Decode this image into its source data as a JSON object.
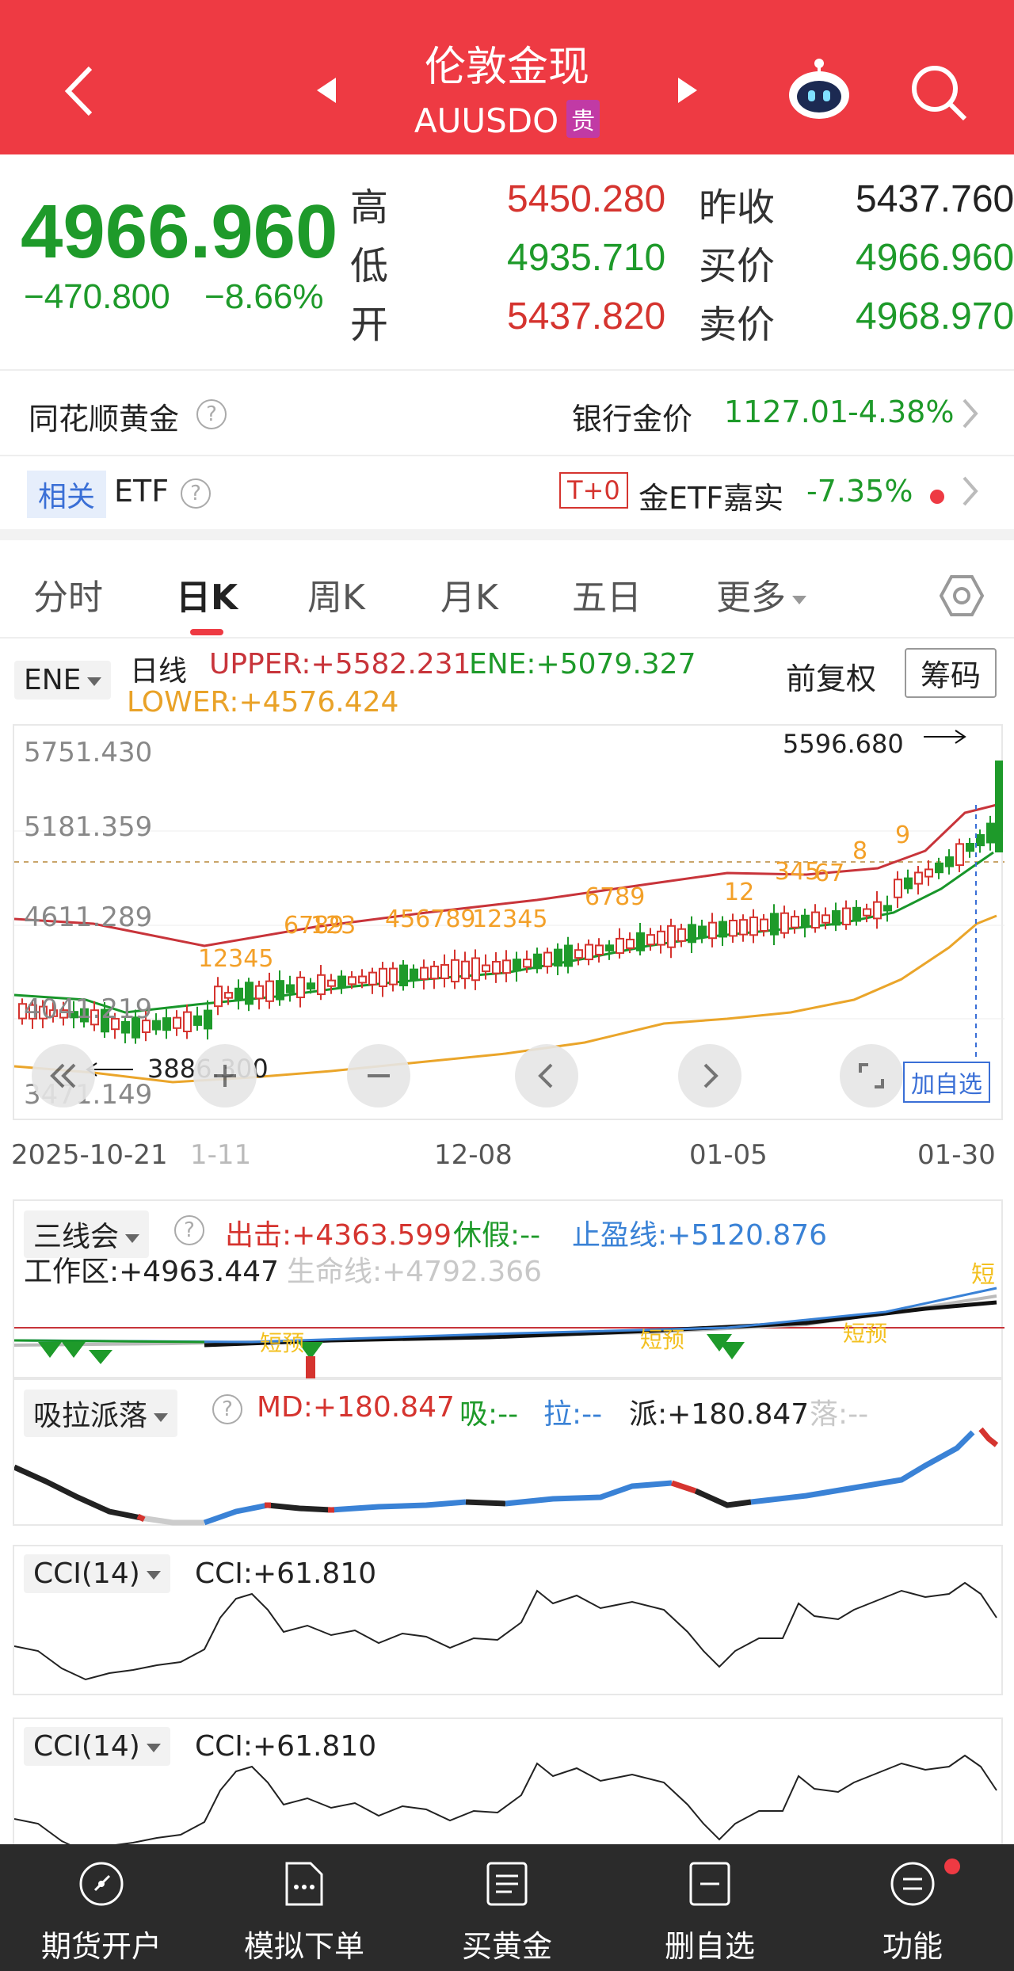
{
  "header": {
    "title": "伦敦金现",
    "symbol": "AUUSDO",
    "badge": "贵"
  },
  "quote": {
    "price": "4966.960",
    "change": "−470.800",
    "change_pct": "−8.66%",
    "high_label": "高",
    "high": "5450.280",
    "low_label": "低",
    "low": "4935.710",
    "open_label": "开",
    "open": "5437.820",
    "prev_close_label": "昨收",
    "prev_close": "5437.760",
    "bid_label": "买价",
    "bid": "4966.960",
    "ask_label": "卖价",
    "ask": "4968.970"
  },
  "ths_gold": {
    "label": "同花顺黄金",
    "bank_label": "银行金价",
    "bank_price": "1127.01",
    "bank_pct": "-4.38%"
  },
  "etf": {
    "tag": "相关",
    "label": "ETF",
    "t0": "T+0",
    "name": "金ETF嘉实",
    "pct": "-7.35%"
  },
  "tabs": [
    "分时",
    "日K",
    "周K",
    "月K",
    "五日",
    "更多"
  ],
  "kline": {
    "indicator": "ENE",
    "period": "日线",
    "upper": "UPPER:+5582.231",
    "ene": "ENE:+5079.327",
    "lower": "LOWER:+4576.424",
    "adjust": "前复权",
    "chips": "筹码",
    "y_ticks": [
      "5751.430",
      "5181.359",
      "4611.289",
      "4041.219",
      "3471.149"
    ],
    "x_ticks": [
      "2025-10-21",
      "1-11",
      "12-08",
      "01-05",
      "01-30"
    ],
    "max_label": "5596.680",
    "min_label": "3886.300",
    "add_watch": "加自选",
    "seq_labels": [
      "12345",
      "6789",
      "123",
      "456789",
      "12345",
      "6789",
      "12",
      "345",
      "67",
      "8",
      "9"
    ]
  },
  "sanxian": {
    "name": "三线会",
    "chuji": "出击:+4363.599",
    "xiujia": "休假:--",
    "zhiying": "止盈线:+5120.876",
    "work": "工作区:+4963.447",
    "life": "生命线:+4792.366",
    "tags": [
      "短",
      "短预",
      "短预",
      "短预"
    ]
  },
  "xila": {
    "name": "吸拉派落",
    "md": "MD:+180.847",
    "xi": "吸:--",
    "la": "拉:--",
    "pai": "派:+180.847",
    "luo": "落:--"
  },
  "cci1": {
    "name": "CCI(14)",
    "value": "CCI:+61.810"
  },
  "cci2": {
    "name": "CCI(14)",
    "value": "CCI:+61.810"
  },
  "nav": [
    "期货开户",
    "模拟下单",
    "买黄金",
    "删自选",
    "功能"
  ],
  "colors": {
    "accent": "#ee3a43",
    "up": "#d5342f",
    "down": "#1e9a2a"
  }
}
